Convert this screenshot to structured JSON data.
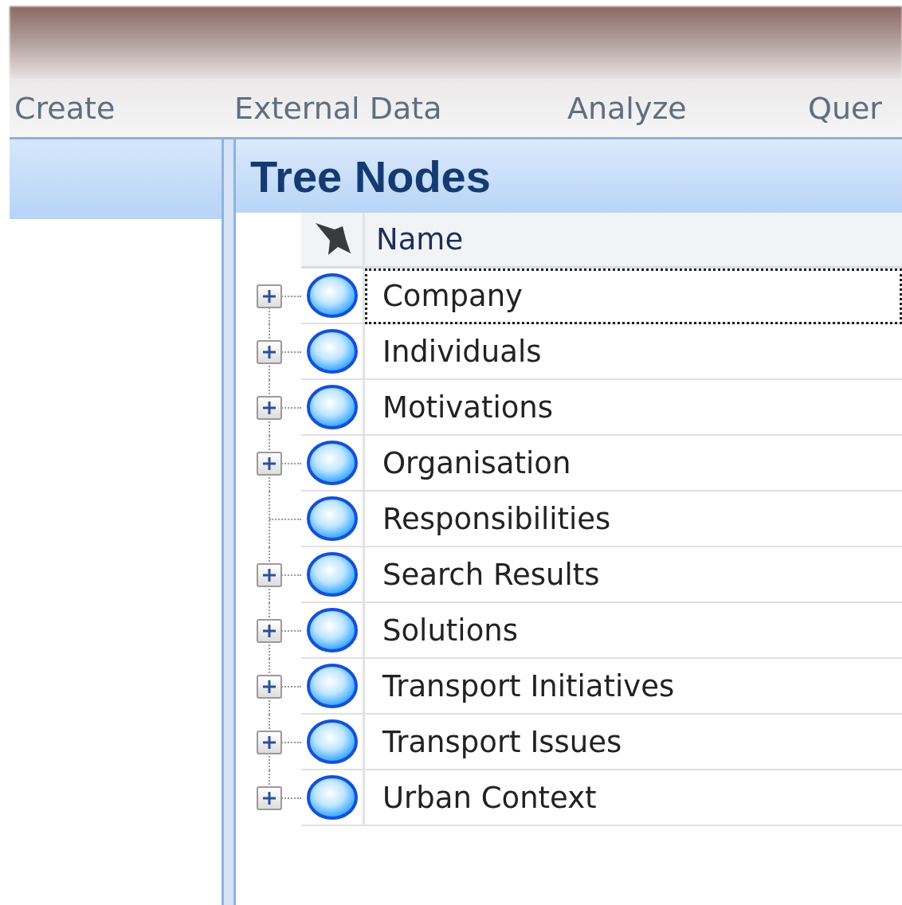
{
  "ribbon_tabs": [
    {
      "label": "Create"
    },
    {
      "label": "External Data"
    },
    {
      "label": "Analyze"
    },
    {
      "label": "Quer"
    }
  ],
  "panel": {
    "title": "Tree Nodes"
  },
  "table": {
    "columns": [
      "Name"
    ],
    "rows": [
      {
        "name": "Company",
        "expandable": true,
        "selected": true
      },
      {
        "name": "Individuals",
        "expandable": true,
        "selected": false
      },
      {
        "name": "Motivations",
        "expandable": true,
        "selected": false
      },
      {
        "name": "Organisation",
        "expandable": true,
        "selected": false
      },
      {
        "name": "Responsibilities",
        "expandable": false,
        "selected": false
      },
      {
        "name": "Search Results",
        "expandable": true,
        "selected": false
      },
      {
        "name": "Solutions",
        "expandable": true,
        "selected": false
      },
      {
        "name": "Transport Initiatives",
        "expandable": true,
        "selected": false
      },
      {
        "name": "Transport Issues",
        "expandable": true,
        "selected": false
      },
      {
        "name": "Urban Context",
        "expandable": true,
        "selected": false
      }
    ]
  }
}
